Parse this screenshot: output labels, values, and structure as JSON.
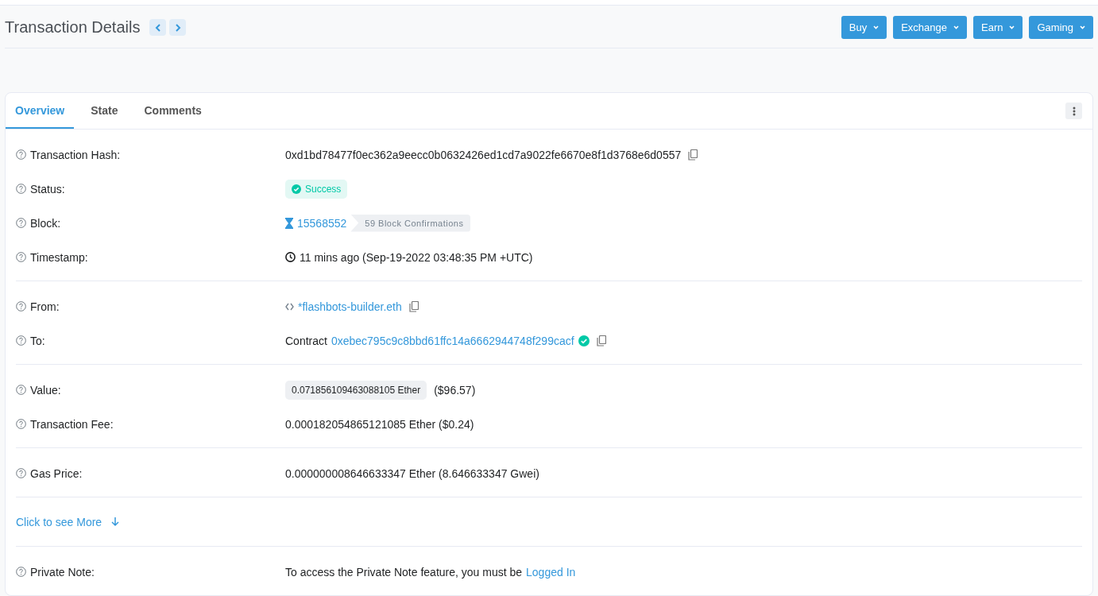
{
  "header": {
    "title": "Transaction Details",
    "nav": [
      {
        "kind": "prev"
      },
      {
        "kind": "next"
      }
    ],
    "menus": [
      {
        "label": "Buy"
      },
      {
        "label": "Exchange"
      },
      {
        "label": "Earn"
      },
      {
        "label": "Gaming"
      }
    ]
  },
  "tabs": [
    {
      "label": "Overview",
      "selected": true
    },
    {
      "label": "State",
      "selected": false
    },
    {
      "label": "Comments",
      "selected": false
    }
  ],
  "sections": [
    {
      "kind": "rows",
      "rows": [
        {
          "kind": "hash",
          "label": "Transaction Hash:",
          "value": "0xd1bd78477f0ec362a9eecc0b0632426ed1cd7a9022fe6670e8f1d3768e6d0557"
        },
        {
          "kind": "status",
          "label": "Status:",
          "value": "Success"
        },
        {
          "kind": "block",
          "label": "Block:",
          "value": "15568552",
          "confirmations": "59 Block Confirmations"
        },
        {
          "kind": "timestamp",
          "label": "Timestamp:",
          "value": "11 mins ago (Sep-19-2022 03:48:35 PM +UTC)"
        }
      ]
    },
    {
      "kind": "rows",
      "rows": [
        {
          "kind": "address",
          "label": "From:",
          "value": "*flashbots-builder.eth"
        },
        {
          "kind": "contract",
          "label": "To:",
          "prefix": "Contract",
          "value": "0xebec795c9c8bbd61ffc14a6662944748f299cacf"
        }
      ]
    },
    {
      "kind": "rows",
      "rows": [
        {
          "kind": "amount",
          "label": "Value:",
          "value": "0.071856109463088105 Ether",
          "usd": "($96.57)"
        },
        {
          "kind": "text",
          "label": "Transaction Fee:",
          "value": "0.000182054865121085 Ether ($0.24)"
        }
      ]
    },
    {
      "kind": "rows",
      "rows": [
        {
          "kind": "text",
          "label": "Gas Price:",
          "value": "0.000000008646633347 Ether (8.646633347 Gwei)"
        }
      ]
    },
    {
      "kind": "more",
      "label": "Click to see More"
    },
    {
      "kind": "rows",
      "rows": [
        {
          "kind": "note",
          "label": "Private Note:",
          "value": "To access the Private Note feature, you must be",
          "link": "Logged In"
        }
      ]
    }
  ]
}
